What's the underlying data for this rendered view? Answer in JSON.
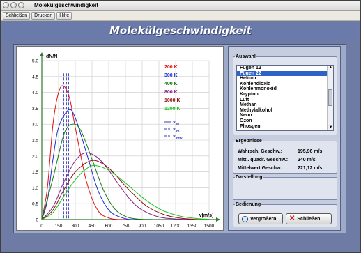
{
  "window": {
    "title": "Molekülgeschwindigkeit"
  },
  "menu": {
    "items": [
      "Schließen",
      "Drucken",
      "Hilfe"
    ]
  },
  "header": {
    "title": "Molekülgeschwindigkeit"
  },
  "chart": {
    "ylabel": "dN/N",
    "xlabel": "v[m/s]",
    "x_ticks": [
      "0",
      "150",
      "300",
      "450",
      "600",
      "750",
      "900",
      "1050",
      "1200",
      "1350",
      "1500"
    ],
    "y_ticks": [
      "0",
      "0.5",
      "1.0",
      "1.5",
      "2.0",
      "2.5",
      "3.0",
      "3.5",
      "4.0",
      "4.5",
      "5.0"
    ],
    "temps": [
      {
        "label": "200 K",
        "color": "#e01010"
      },
      {
        "label": "300 K",
        "color": "#1b2fd0"
      },
      {
        "label": "400 K",
        "color": "#127a12"
      },
      {
        "label": "800 K",
        "color": "#8a1a8a"
      },
      {
        "label": "1000 K",
        "color": "#8a1010"
      },
      {
        "label": "1200 K",
        "color": "#21c421"
      }
    ],
    "velocity_legend": [
      {
        "label": "v",
        "sub": "w"
      },
      {
        "label": "v",
        "sub": "m"
      },
      {
        "label": "v",
        "sub": "mw"
      }
    ]
  },
  "chart_data": {
    "type": "line",
    "xlabel": "v[m/s]",
    "ylabel": "dN/N",
    "xlim": [
      0,
      1500
    ],
    "ylim": [
      0,
      5.0
    ],
    "grid": true,
    "legend_position": "top-right",
    "series": [
      {
        "name": "200 K",
        "color": "#e01010",
        "x": [
          0,
          50,
          100,
          150,
          196,
          250,
          300,
          400,
          500,
          600,
          700,
          800
        ],
        "y": [
          0,
          1.0,
          3.0,
          4.0,
          4.2,
          3.8,
          2.9,
          1.2,
          0.3,
          0.05,
          0,
          0
        ]
      },
      {
        "name": "300 K",
        "color": "#1b2fd0",
        "x": [
          0,
          50,
          100,
          150,
          240,
          300,
          400,
          500,
          600,
          700,
          800,
          900
        ],
        "y": [
          0,
          0.6,
          1.9,
          2.9,
          3.45,
          3.2,
          2.1,
          0.95,
          0.3,
          0.08,
          0,
          0
        ]
      },
      {
        "name": "400 K",
        "color": "#127a12",
        "x": [
          0,
          100,
          200,
          278,
          350,
          450,
          550,
          650,
          750,
          850,
          1000
        ],
        "y": [
          0,
          1.3,
          2.7,
          3.0,
          2.8,
          1.9,
          0.95,
          0.35,
          0.1,
          0.02,
          0
        ]
      },
      {
        "name": "800 K",
        "color": "#8a1a8a",
        "x": [
          0,
          100,
          200,
          300,
          393,
          500,
          600,
          700,
          800,
          900,
          1050,
          1200,
          1350
        ],
        "y": [
          0,
          0.4,
          1.2,
          1.85,
          2.1,
          1.95,
          1.55,
          1.05,
          0.6,
          0.3,
          0.08,
          0.02,
          0
        ]
      },
      {
        "name": "1000 K",
        "color": "#8a1010",
        "x": [
          0,
          100,
          200,
          300,
          439,
          550,
          650,
          750,
          850,
          950,
          1100,
          1250,
          1400
        ],
        "y": [
          0,
          0.3,
          0.95,
          1.5,
          1.85,
          1.75,
          1.45,
          1.05,
          0.7,
          0.4,
          0.15,
          0.04,
          0
        ]
      },
      {
        "name": "1200 K",
        "color": "#21c421",
        "x": [
          0,
          100,
          200,
          300,
          400,
          481,
          600,
          700,
          800,
          900,
          1000,
          1100,
          1250,
          1400,
          1500
        ],
        "y": [
          0,
          0.22,
          0.75,
          1.25,
          1.6,
          1.7,
          1.55,
          1.3,
          1.0,
          0.7,
          0.45,
          0.26,
          0.1,
          0.03,
          0.01
        ]
      }
    ],
    "markers": [
      {
        "name": "v_w",
        "x": 196,
        "color": "#3b3bb8"
      },
      {
        "name": "v_m",
        "x": 240,
        "color": "#3b3bb8"
      },
      {
        "name": "v_mw",
        "x": 221,
        "color": "#3b3bb8"
      }
    ]
  },
  "sidebar": {
    "auswahl_title": "Auswahl",
    "gases": [
      "Fügen 12",
      "Fügen 22",
      "Helium",
      "Kohlendioxid",
      "Kohlenmonoxid",
      "Krypton",
      "Luft",
      "Methan",
      "Methylalkohol",
      "Neon",
      "Ozon",
      "Phosgen"
    ],
    "selected_gas": "Fügen 22",
    "ergebnisse_title": "Ergebnisse",
    "results": [
      {
        "label": "Wahrsch. Geschw.:",
        "value": "195,96 m/s"
      },
      {
        "label": "Mittl. quadr. Geschw.:",
        "value": "240 m/s"
      },
      {
        "label": "Mittelwert Geschw.:",
        "value": "221,12 m/s"
      }
    ],
    "darstellung_title": "Darstellung",
    "bedienung_title": "Bedienung",
    "zoom_label": "Vergrößern",
    "close_label": "Schließen"
  }
}
